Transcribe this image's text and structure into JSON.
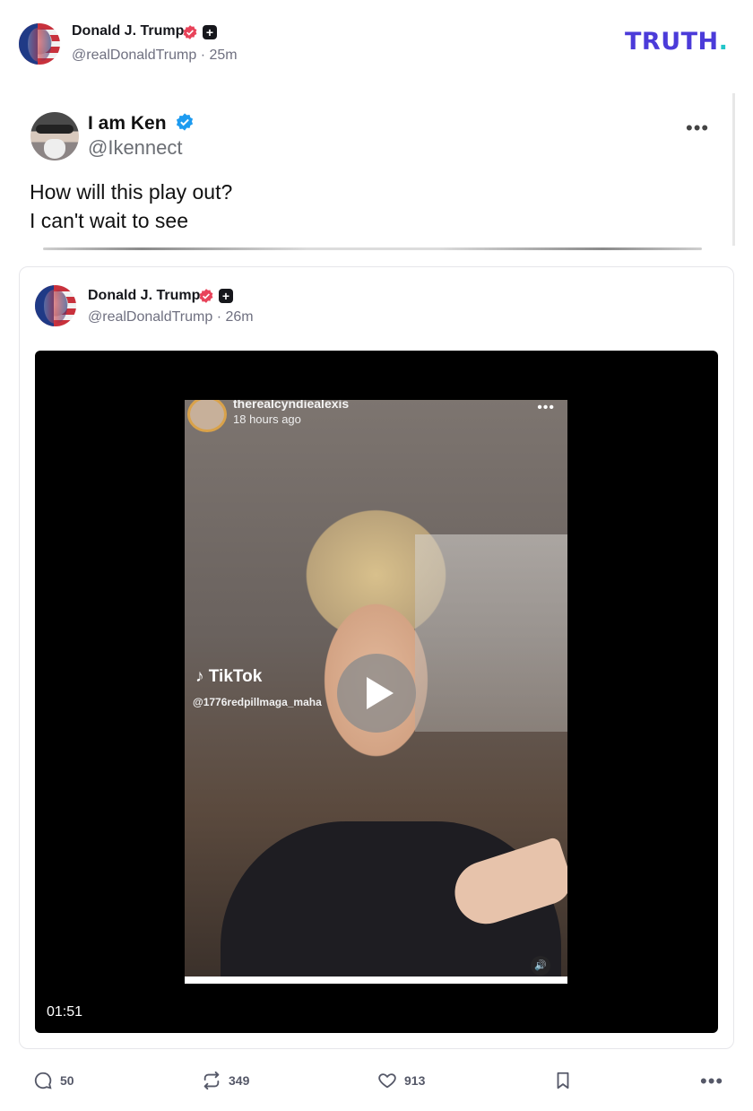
{
  "header": {
    "author_name": "Donald J. Trump",
    "author_handle": "@realDonaldTrump",
    "time": "25m",
    "brand": "TRUTH",
    "brand_dot": "."
  },
  "embedded_tweet": {
    "name": "I am Ken",
    "handle": "@Ikennect",
    "text_line1": "How will this play out?",
    "text_line2": "I can't wait to see"
  },
  "quote": {
    "author_name": "Donald J. Trump",
    "author_handle": "@realDonaldTrump",
    "time": "26m",
    "video": {
      "overlay_user": "therealcyndiealexis",
      "overlay_time": "18 hours ago",
      "watermark": "TikTok",
      "watermark_handle": "@1776redpillmaga_maha",
      "duration": "01:51"
    }
  },
  "actions": {
    "replies": "50",
    "retruths": "349",
    "likes": "913"
  },
  "colors": {
    "brand": "#4b3bd9",
    "brand_dot": "#22c6c9",
    "verified_red": "#e8435a",
    "verified_blue": "#1d9bf0"
  }
}
